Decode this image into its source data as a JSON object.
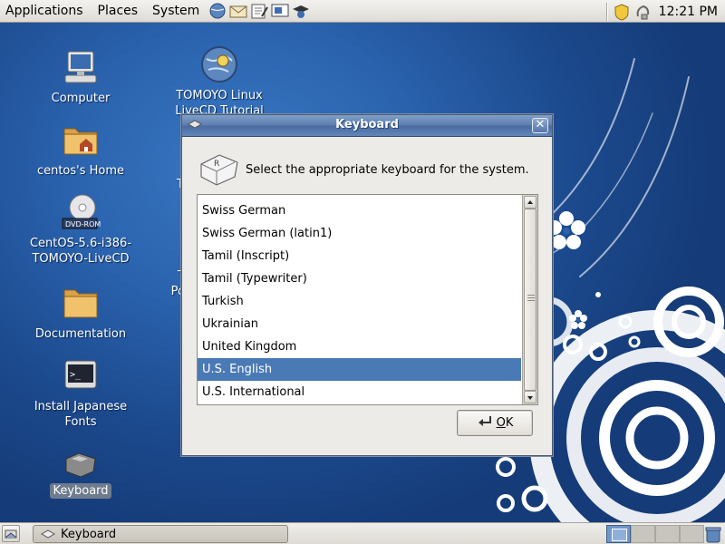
{
  "top_panel": {
    "menus": [
      "Applications",
      "Places",
      "System"
    ],
    "launchers": [
      "network-globe-icon",
      "mail-icon",
      "text-editor-icon",
      "presentation-icon",
      "help-mortarboard-icon"
    ],
    "clock": "12:21 PM"
  },
  "desktop_icons": [
    {
      "label": "Computer",
      "icon": "computer-icon"
    },
    {
      "label": "centos's Home",
      "icon": "home-folder-icon"
    },
    {
      "label": "CentOS-5.6-i386-\nTOMOYO-LiveCD",
      "icon": "dvd-icon"
    },
    {
      "label": "Documentation",
      "icon": "folder-icon"
    },
    {
      "label": "Install Japanese\nFonts",
      "icon": "terminal-icon"
    },
    {
      "label": "Keyboard",
      "icon": "keyboard-icon"
    },
    {
      "label": "TOMOYO Linux\nLiveCD Tutorial",
      "icon": "globe-icon"
    },
    {
      "label": "T",
      "icon": ""
    },
    {
      "label": "T\nPo",
      "icon": ""
    }
  ],
  "dialog": {
    "title": "Keyboard",
    "prompt": "Select the appropriate keyboard for the system.",
    "items": [
      "Swiss German",
      "Swiss German (latin1)",
      "Tamil (Inscript)",
      "Tamil (Typewriter)",
      "Turkish",
      "Ukrainian",
      "United Kingdom",
      "U.S. English",
      "U.S. International"
    ],
    "selected": "U.S. English",
    "ok_key": "O",
    "ok_rest": "K"
  },
  "bottom_panel": {
    "task_label": "Keyboard"
  },
  "colors": {
    "selection": "#4a7ab5",
    "titlebar": "#5b7cad",
    "desktop": "#1f4f93"
  }
}
